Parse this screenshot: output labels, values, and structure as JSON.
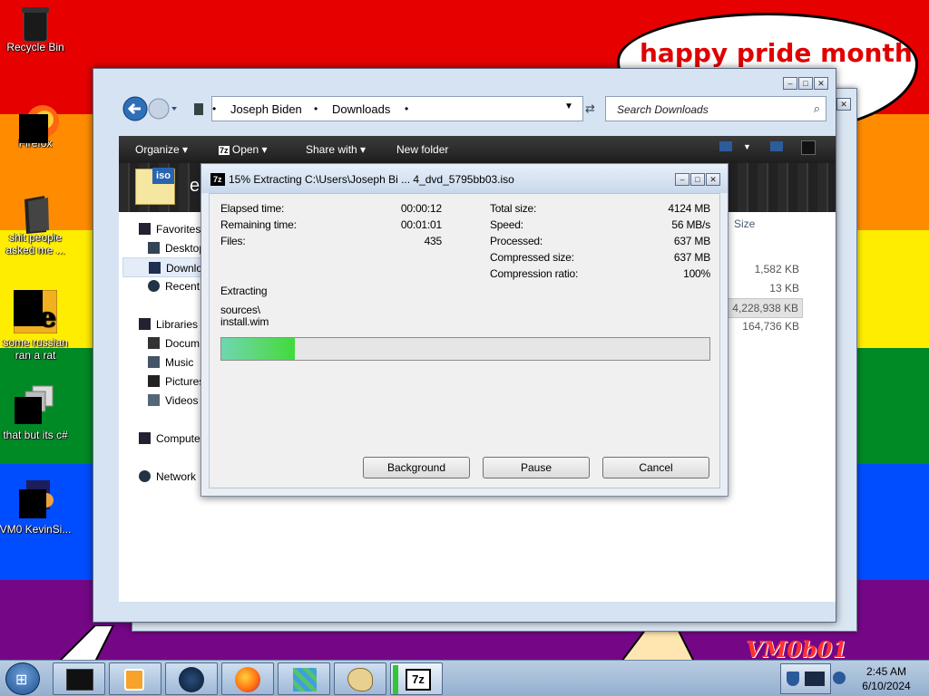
{
  "desktop": {
    "speech_bubble": "happy pride month",
    "watermark": "VM0b01",
    "icons": [
      {
        "label": "Recycle Bin"
      },
      {
        "label": "Firefox"
      },
      {
        "label": "shit people asked me ..."
      },
      {
        "label": "some russian ran a rat"
      },
      {
        "label": "that but its c#"
      },
      {
        "label": "VM0 KevinSi..."
      }
    ]
  },
  "explorer": {
    "breadcrumb": [
      "Joseph Biden",
      "Downloads"
    ],
    "search_placeholder": "Search Downloads",
    "toolbar": {
      "organize": "Organize",
      "open": "Open",
      "share_with": "Share with",
      "new_folder": "New folder"
    },
    "header_letter": "e",
    "column_size": "Size",
    "nav": {
      "favorites": "Favorites",
      "desktop": "Desktop",
      "downloads": "Downlo",
      "recent": "Recent",
      "libraries": "Libraries",
      "documents": "Docum",
      "music": "Music",
      "pictures": "Pictures",
      "videos": "Videos",
      "computer": "Compute",
      "network": "Network"
    },
    "sizes": [
      "1,582 KB",
      "13 KB",
      "4,228,938 KB",
      "164,736 KB"
    ]
  },
  "dialog": {
    "title": "15% Extracting C:\\Users\\Joseph Bi ... 4_dvd_5795bb03.iso",
    "app_icon": "7z",
    "elapsed_label": "Elapsed time:",
    "elapsed_value": "00:00:12",
    "remaining_label": "Remaining time:",
    "remaining_value": "00:01:01",
    "files_label": "Files:",
    "files_value": "435",
    "total_size_label": "Total size:",
    "total_size_value": "4124 MB",
    "speed_label": "Speed:",
    "speed_value": "56 MB/s",
    "processed_label": "Processed:",
    "processed_value": "637 MB",
    "compressed_label": "Compressed size:",
    "compressed_value": "637 MB",
    "ratio_label": "Compression ratio:",
    "ratio_value": "100%",
    "status": "Extracting",
    "path_line1": "sources\\",
    "path_line2": "install.wim",
    "progress_percent": 15,
    "buttons": {
      "background": "Background",
      "pause": "Pause",
      "cancel": "Cancel"
    }
  },
  "taskbar": {
    "time": "2:45 AM",
    "date": "6/10/2024",
    "sevenzip_label": "7z"
  }
}
